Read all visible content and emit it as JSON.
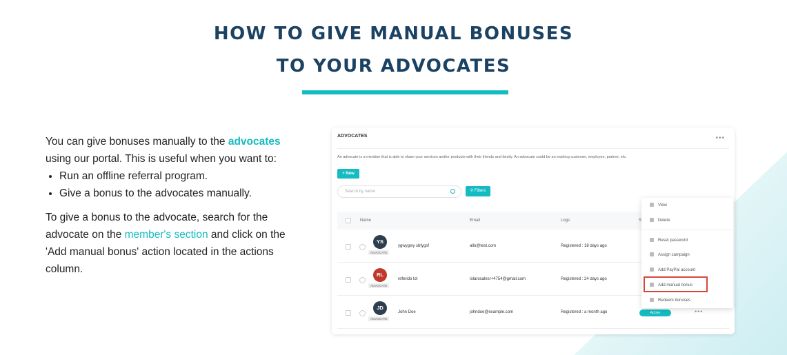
{
  "heading": {
    "line1": "HOW TO GIVE MANUAL BONUSES",
    "line2": "TO YOUR ADVOCATES"
  },
  "intro": {
    "p1_before": "You can give bonuses manually to the ",
    "p1_link": "advocates",
    "p1_after": " using our portal. This is useful when you want to:",
    "bullets": [
      "Run an offline referral program.",
      "Give a bonus to the advocates manually."
    ],
    "p2_before": "To give a bonus to the advocate, search for the advocate on the ",
    "p2_link": "member's section",
    "p2_after": " and click on the 'Add manual bonus' action located in the actions column."
  },
  "portal": {
    "title": "ADVOCATES",
    "description": "An advocate is a member that is able to share your services and/or products with their friends and family. An advocate could be an existing customer, employee, partner, etc.",
    "new_button": "+ New",
    "search_placeholder": "Search by name",
    "filters_button": "Filters",
    "columns": {
      "name": "Name",
      "email": "Email",
      "logs": "Logs",
      "status": "S"
    },
    "rows": [
      {
        "initials": "YS",
        "avatar_color": "#2f3e4e",
        "name": "ygwygwy sbfygsf",
        "badge": "ADVOCATE",
        "email": "allo@test.com",
        "logs": "Registered : 18 days ago"
      },
      {
        "initials": "RL",
        "avatar_color": "#c0392b",
        "name": "referido lot",
        "badge": "ADVOCATE",
        "email": "lolarosalesr+4754@gmail.com",
        "logs": "Registered : 24 days ago"
      },
      {
        "initials": "JD",
        "avatar_color": "#2f3e4e",
        "name": "John Doe",
        "badge": "ADVOCATE",
        "email": "johndoe@example.com",
        "logs": "Registered : a month ago",
        "status": "Active"
      }
    ],
    "menu": [
      "View",
      "Delete",
      "Reset password",
      "Assign campaign",
      "Add PayPal account",
      "Add manual bonus",
      "Redeem bonuses"
    ]
  },
  "colors": {
    "accent": "#14bcc1",
    "heading": "#1b4262",
    "highlight": "#d9453b"
  }
}
